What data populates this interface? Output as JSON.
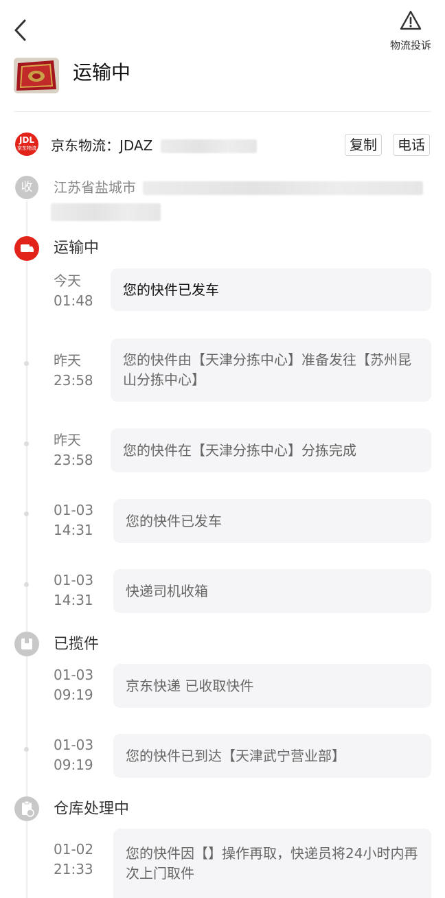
{
  "header": {
    "complaint_label": "物流投诉",
    "status_title": "运输中"
  },
  "carrier": {
    "logo_text": "JDL",
    "logo_subtext": "京东物流",
    "label": "京东物流：JDAZ",
    "copy_label": "复制",
    "call_label": "电话"
  },
  "receiver": {
    "badge": "收",
    "address": "江苏省盐城市"
  },
  "timeline": {
    "in_transit_label": "运输中",
    "picked_up_label": "已揽件",
    "warehouse_label": "仓库处理中",
    "events": [
      {
        "date": "今天",
        "time": "01:48",
        "text": "您的快件已发车"
      },
      {
        "date": "昨天",
        "time": "23:58",
        "text": "您的快件由【天津分拣中心】准备发往【苏州昆山分拣中心】"
      },
      {
        "date": "昨天",
        "time": "23:58",
        "text": "您的快件在【天津分拣中心】分拣完成"
      },
      {
        "date": "01-03",
        "time": "14:31",
        "text": "您的快件已发车"
      },
      {
        "date": "01-03",
        "time": "14:31",
        "text": "快递司机收箱"
      },
      {
        "date": "01-03",
        "time": "09:19",
        "text": "京东快递 已收取快件"
      },
      {
        "date": "01-03",
        "time": "09:19",
        "text": "您的快件已到达【天津武宁营业部】"
      },
      {
        "date": "01-02",
        "time": "21:33",
        "text": "您的快件因【】操作再取，快递员将24小时内再次上门取件"
      }
    ]
  },
  "colors": {
    "accent": "#e2231a",
    "muted_icon": "#c8c8c8",
    "card_bg": "#f5f5f7"
  }
}
